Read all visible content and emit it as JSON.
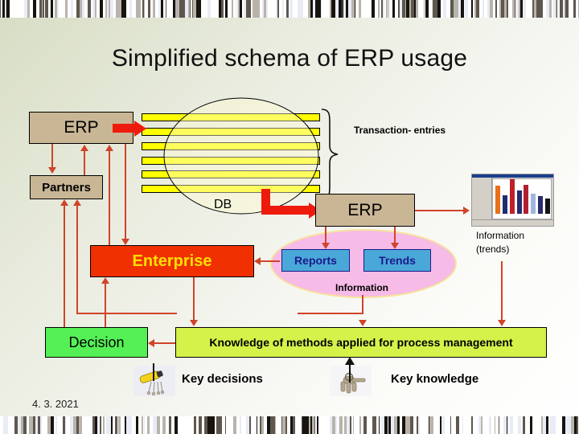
{
  "slide": {
    "title": "Simplified  schema of ERP usage",
    "date": "4. 3. 2021"
  },
  "nodes": {
    "erp_top": "ERP",
    "partners": "Partners",
    "db_label": "DB",
    "transaction_entries": "Transaction- entries",
    "erp_mid": "ERP",
    "reports": "Reports",
    "trends": "Trends",
    "information": "Information",
    "information_trends_line1": "Information",
    "information_trends_line2": "(trends)",
    "enterprise": "Enterprise",
    "decision": "Decision",
    "knowledge": "Knowledge of methods applied for process management",
    "key_decisions": "Key decisions",
    "key_knowledge": "Key knowledge"
  },
  "colors": {
    "box_tan": "#c9b695",
    "enterprise_red": "#f03000",
    "enterprise_text": "#ffe000",
    "decision_green": "#55f055",
    "knowledge_green": "#d4f24a",
    "reports_blue": "#4aa8d8",
    "reports_text": "#1a1a8c",
    "arrow_red": "#d0442a",
    "fat_arrow_red": "#ee1b0c",
    "db_fill": "#fdfbd0",
    "bar_yellow": "#ffff00",
    "info_pink": "#f7bbe7",
    "background_green": "#d7ddc4"
  },
  "chart_thumbnail": {
    "type": "bar",
    "bar_colors": [
      "#e8701a",
      "#1b2f70",
      "#c0202a",
      "#2a2a6e",
      "#b02030",
      "#9fb6de",
      "#2a2a6e",
      "#141414"
    ],
    "bar_heights": [
      70,
      45,
      85,
      58,
      72,
      50,
      44,
      38
    ]
  }
}
